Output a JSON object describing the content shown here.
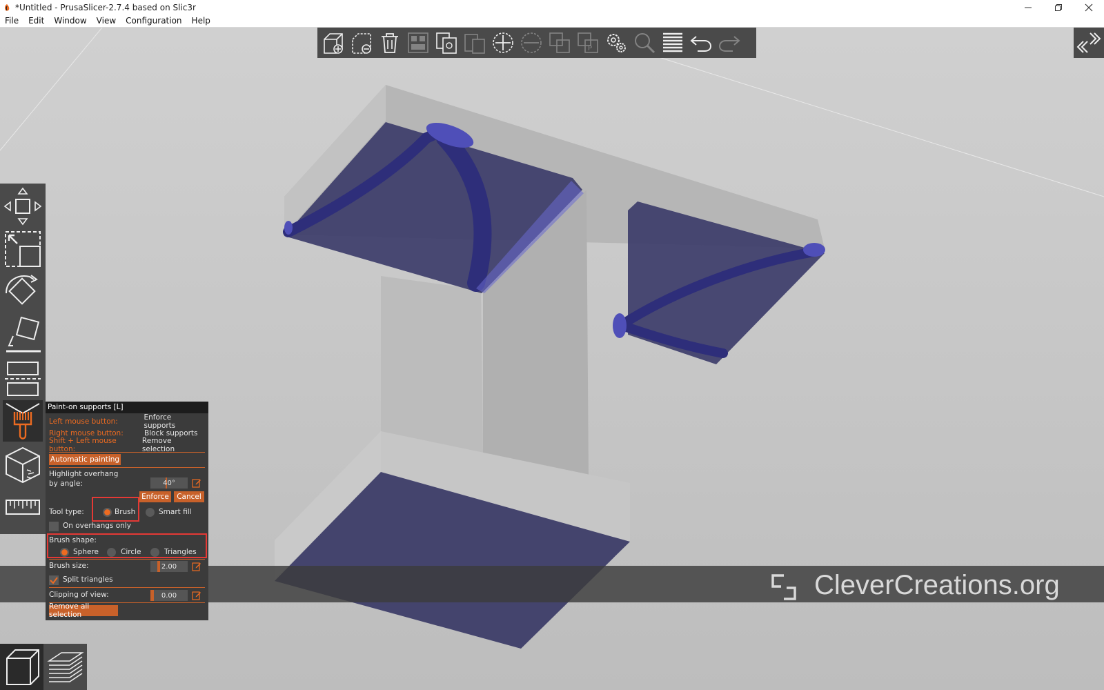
{
  "window": {
    "title": "*Untitled - PrusaSlicer-2.7.4 based on Slic3r",
    "controls": [
      "minimize",
      "restore",
      "close"
    ]
  },
  "menu": [
    "File",
    "Edit",
    "Window",
    "View",
    "Configuration",
    "Help"
  ],
  "top_toolbar": [
    {
      "name": "add-icon",
      "enabled": true
    },
    {
      "name": "delete-icon",
      "enabled": true
    },
    {
      "name": "delete-all-icon",
      "enabled": true
    },
    {
      "name": "arrange-icon",
      "enabled": false
    },
    {
      "name": "copy-icon",
      "enabled": true
    },
    {
      "name": "paste-icon",
      "enabled": false
    },
    {
      "name": "add-instance-icon",
      "enabled": true
    },
    {
      "name": "remove-instance-icon",
      "enabled": false
    },
    {
      "name": "split-objects-icon",
      "enabled": false
    },
    {
      "name": "split-parts-icon",
      "enabled": false
    },
    {
      "name": "variable-layer-height-icon",
      "enabled": true
    },
    {
      "name": "search-icon",
      "enabled": false
    },
    {
      "name": "layers-editing-icon",
      "enabled": true
    },
    {
      "name": "undo-icon",
      "enabled": true
    },
    {
      "name": "redo-icon",
      "enabled": false
    }
  ],
  "panel": {
    "title": "Paint-on supports [L]",
    "hints": [
      {
        "key": "Left mouse button:",
        "value": "Enforce supports"
      },
      {
        "key": "Right mouse button:",
        "value": "Block supports"
      },
      {
        "key": "Shift + Left mouse button:",
        "value": "Remove selection"
      }
    ],
    "auto_paint": "Automatic painting",
    "highlight_label_1": "Highlight overhang",
    "highlight_label_2": "by angle:",
    "angle_value": "40°",
    "angle_fraction": 0.44,
    "enforce": "Enforce",
    "cancel": "Cancel",
    "tool_type_label": "Tool type:",
    "tool_brush": "Brush",
    "tool_smart_fill": "Smart fill",
    "tool_selected": "Brush",
    "overhangs_only": "On overhangs only",
    "overhangs_only_checked": false,
    "brush_shape_label": "Brush shape:",
    "shape_sphere": "Sphere",
    "shape_circle": "Circle",
    "shape_triangles": "Triangles",
    "shape_selected": "Sphere",
    "brush_size_label": "Brush size:",
    "brush_size_value": "2.00",
    "brush_size_fraction": 0.2,
    "split_triangles": "Split triangles",
    "split_triangles_checked": true,
    "clipping_label": "Clipping of view:",
    "clipping_value": "0.00",
    "clipping_fraction": 0.0,
    "remove_all": "Remove all selection"
  },
  "watermark": "CleverCreations.org",
  "colors": {
    "accent": "#ed6b21",
    "paint": "#3a3a8a",
    "toolbar_bg": "#4a4a4a"
  }
}
